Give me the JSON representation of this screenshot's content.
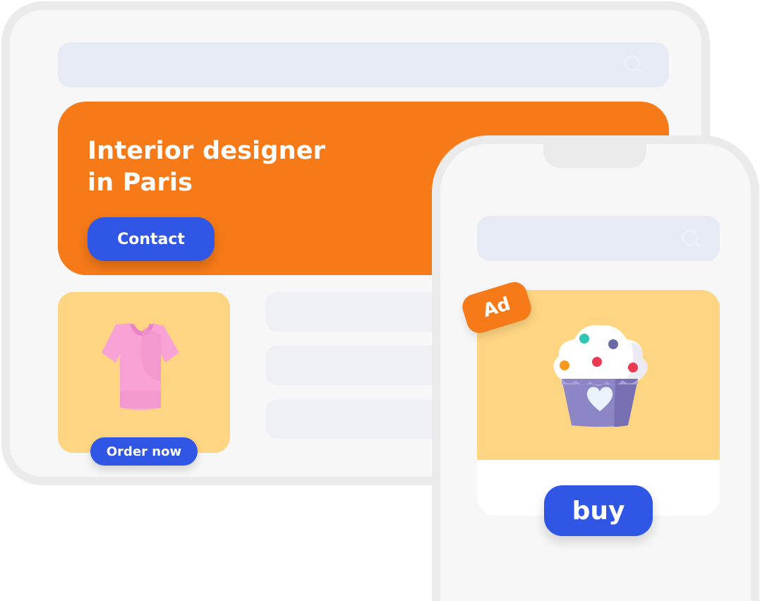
{
  "tablet": {
    "hero": {
      "title_line1": "Interior designer",
      "title_line2": "in Paris",
      "cta_label": "Contact"
    },
    "product": {
      "icon": "tshirt-icon",
      "cta_label": "Order now"
    }
  },
  "phone": {
    "ad_badge": "Ad",
    "product_icon": "cupcake-icon",
    "cta_label": "buy"
  },
  "colors": {
    "accent_orange": "#f77a18",
    "button_blue": "#2f56e4",
    "card_yellow": "#fed683",
    "search_bg": "#e6ebf5"
  }
}
